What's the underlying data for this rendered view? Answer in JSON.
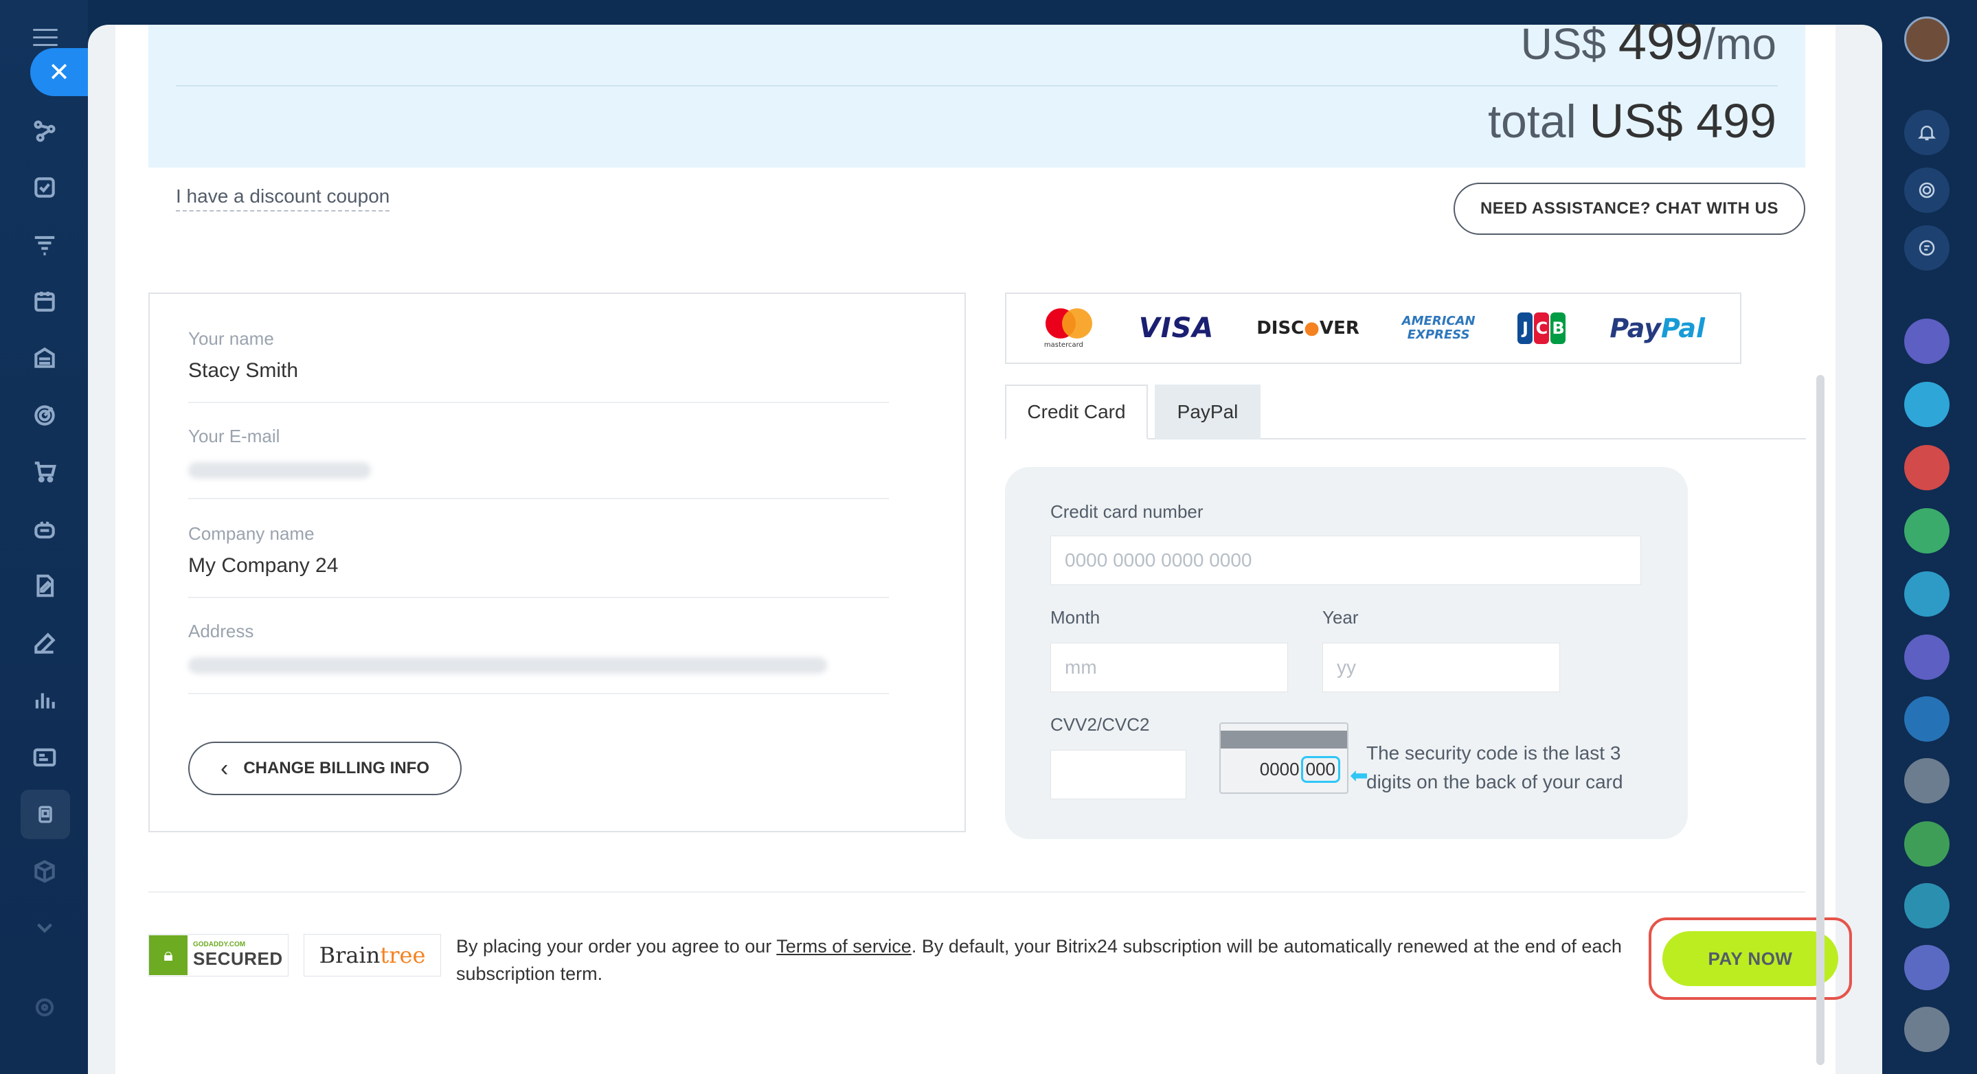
{
  "pricing": {
    "monthly_prefix": "US$ ",
    "monthly_amount": "499",
    "monthly_suffix": "/mo",
    "total_prefix": "total ",
    "total_amount": "US$ 499"
  },
  "coupon_link": "I have a discount coupon",
  "assistance_button": "NEED ASSISTANCE? CHAT WITH US",
  "billing": {
    "name_label": "Your name",
    "name_value": "Stacy Smith",
    "email_label": "Your E-mail",
    "company_label": "Company name",
    "company_value": "My Company 24",
    "address_label": "Address",
    "change_button": "CHANGE BILLING INFO"
  },
  "payment_logos": [
    "mastercard",
    "VISA",
    "DISCOVER",
    "AMERICAN EXPRESS",
    "JCB",
    "PayPal"
  ],
  "tabs": [
    {
      "label": "Credit Card",
      "active": true
    },
    {
      "label": "PayPal",
      "active": false
    }
  ],
  "card_form": {
    "number_label": "Credit card number",
    "number_placeholder": "0000 0000 0000 0000",
    "month_label": "Month",
    "month_placeholder": "mm",
    "year_label": "Year",
    "year_placeholder": "yy",
    "cvv_label": "CVV2/CVC2",
    "cvv_card_digits": "0000",
    "cvv_card_code": "000",
    "cvv_hint": "The security code is the last 3 digits on the back of your card"
  },
  "footer": {
    "secured_small": "GODADDY.COM",
    "secured_big": "SECURED",
    "braintree_a": "Brain",
    "braintree_b": "tree",
    "terms_before": "By placing your order you agree to our ",
    "terms_link": "Terms of service",
    "terms_after": ". By default, your Bitrix24 subscription will be automatically renewed at the end of each subscription term.",
    "pay_button": "PAY NOW"
  },
  "colors": {
    "accent_blue": "#1f8af2",
    "pay_button": "#bbed21",
    "highlight_outline": "#e5544a",
    "price_bg": "#e6f4fd"
  }
}
